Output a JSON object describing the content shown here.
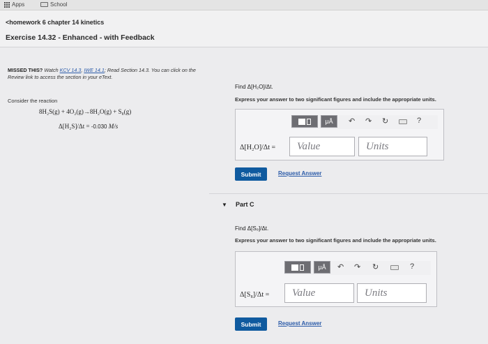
{
  "bookmarks": {
    "apps": "Apps",
    "school": "School"
  },
  "nav": {
    "back": "<homework 6 chapter 14 kinetics",
    "exercise_title": "Exercise 14.32 - Enhanced - with Feedback"
  },
  "missed": {
    "lead": "MISSED THIS?",
    "watch": " Watch ",
    "link1": "KCV 14.3",
    "sep": ", ",
    "link2": "IWE 14.1",
    "rest": "; Read Section 14.3. You can click on the Review link to access the section in your eText."
  },
  "consider": "Consider the reaction",
  "reaction": {
    "equation": "8H₂S(g) + 4O₂(g)→8H₂O(g) + S₈(g)",
    "rate_label": "Δ[H₂S]/Δt = ",
    "rate_value": "-0.030",
    "rate_unit": " M/s"
  },
  "partB": {
    "find": "Find Δ[H₂O]/Δt.",
    "instructions": "Express your answer to two significant figures and include the appropriate units.",
    "eq_label": "Δ[H₂O]/Δt =",
    "value_placeholder": "Value",
    "units_placeholder": "Units",
    "submit": "Submit",
    "request": "Request Answer"
  },
  "partC": {
    "toggle": "▼",
    "title": "Part C",
    "find": "Find Δ[S₈]/Δt.",
    "instructions": "Express your answer to two significant figures and include the appropriate units.",
    "eq_label": "Δ[S₈]/Δt =",
    "value_placeholder": "Value",
    "units_placeholder": "Units",
    "submit": "Submit",
    "request": "Request Answer"
  },
  "toolbar": {
    "templates_icon": "templates-icon",
    "units_label": "μÅ",
    "undo_icon": "undo-icon",
    "redo_icon": "redo-icon",
    "reset_icon": "reset-icon",
    "keyboard_icon": "keyboard-icon",
    "help_label": "?"
  },
  "colors": {
    "submit_bg": "#0f5a9f",
    "link": "#2a5aa8",
    "page_bg": "#e9e9eb"
  }
}
